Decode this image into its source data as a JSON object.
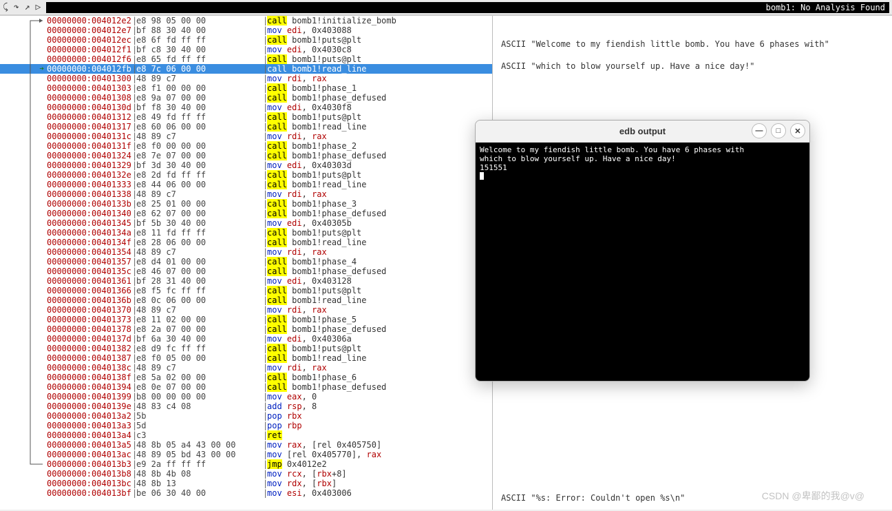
{
  "toolbar": {
    "title": "bomb1: No Analysis Found"
  },
  "info": {
    "ascii1": "ASCII \"Welcome to my fiendish little bomb. You have 6 phases with\"",
    "ascii2": "ASCII \"which to blow yourself up. Have a nice day!\"",
    "bottom": "ASCII \"%s: Error: Couldn't open %s\\n\""
  },
  "output_window": {
    "title": "edb output",
    "lines": "Welcome to my fiendish little bomb. You have 6 phases with\nwhich to blow yourself up. Have a nice day!\n151551"
  },
  "watermark": "CSDN @卑鄙的我@v@",
  "disasm": [
    {
      "g": "",
      "addr": "00000000:004012e2",
      "bytes": "e8 98 05 00 00",
      "mn": "call",
      "hi": true,
      "rest": " bomb1!initialize_bomb"
    },
    {
      "g": "",
      "addr": "00000000:004012e7",
      "bytes": "bf 88 30 40 00",
      "mn": "mov",
      "rest": " ",
      "reg": "edi",
      "after": ", 0x403088"
    },
    {
      "g": "",
      "addr": "00000000:004012ec",
      "bytes": "e8 6f fd ff ff",
      "mn": "call",
      "hi": true,
      "rest": " bomb1!puts@plt"
    },
    {
      "g": "",
      "addr": "00000000:004012f1",
      "bytes": "bf c8 30 40 00",
      "mn": "mov",
      "rest": " ",
      "reg": "edi",
      "after": ", 0x4030c8"
    },
    {
      "g": "",
      "addr": "00000000:004012f6",
      "bytes": "e8 65 fd ff ff",
      "mn": "call",
      "hi": true,
      "rest": " bomb1!puts@plt"
    },
    {
      "g": "rip",
      "sel": true,
      "addr": "00000000:004012fb",
      "bytes": "e8 7c 06 00 00",
      "mn": "call",
      "rest": " bomb1!read_line"
    },
    {
      "g": "",
      "addr": "00000000:00401300",
      "bytes": "48 89 c7",
      "mn": "mov",
      "rest": " ",
      "reg": "rdi",
      "after": ", ",
      "reg2": "rax"
    },
    {
      "g": "",
      "addr": "00000000:00401303",
      "bytes": "e8 f1 00 00 00",
      "mn": "call",
      "hi": true,
      "rest": " bomb1!phase_1"
    },
    {
      "g": "",
      "addr": "00000000:00401308",
      "bytes": "e8 9a 07 00 00",
      "mn": "call",
      "hi": true,
      "rest": " bomb1!phase_defused"
    },
    {
      "g": "",
      "addr": "00000000:0040130d",
      "bytes": "bf f8 30 40 00",
      "mn": "mov",
      "rest": " ",
      "reg": "edi",
      "after": ", 0x4030f8"
    },
    {
      "g": "",
      "addr": "00000000:00401312",
      "bytes": "e8 49 fd ff ff",
      "mn": "call",
      "hi": true,
      "rest": " bomb1!puts@plt"
    },
    {
      "g": "",
      "addr": "00000000:00401317",
      "bytes": "e8 60 06 00 00",
      "mn": "call",
      "hi": true,
      "rest": " bomb1!read_line"
    },
    {
      "g": "",
      "addr": "00000000:0040131c",
      "bytes": "48 89 c7",
      "mn": "mov",
      "rest": " ",
      "reg": "rdi",
      "after": ", ",
      "reg2": "rax"
    },
    {
      "g": "",
      "addr": "00000000:0040131f",
      "bytes": "e8 f0 00 00 00",
      "mn": "call",
      "hi": true,
      "rest": " bomb1!phase_2"
    },
    {
      "g": "",
      "addr": "00000000:00401324",
      "bytes": "e8 7e 07 00 00",
      "mn": "call",
      "hi": true,
      "rest": " bomb1!phase_defused"
    },
    {
      "g": "",
      "addr": "00000000:00401329",
      "bytes": "bf 3d 30 40 00",
      "mn": "mov",
      "rest": " ",
      "reg": "edi",
      "after": ", 0x40303d"
    },
    {
      "g": "",
      "addr": "00000000:0040132e",
      "bytes": "e8 2d fd ff ff",
      "mn": "call",
      "hi": true,
      "rest": " bomb1!puts@plt"
    },
    {
      "g": "",
      "addr": "00000000:00401333",
      "bytes": "e8 44 06 00 00",
      "mn": "call",
      "hi": true,
      "rest": " bomb1!read_line"
    },
    {
      "g": "",
      "addr": "00000000:00401338",
      "bytes": "48 89 c7",
      "mn": "mov",
      "rest": " ",
      "reg": "rdi",
      "after": ", ",
      "reg2": "rax"
    },
    {
      "g": "",
      "addr": "00000000:0040133b",
      "bytes": "e8 25 01 00 00",
      "mn": "call",
      "hi": true,
      "rest": " bomb1!phase_3"
    },
    {
      "g": "",
      "addr": "00000000:00401340",
      "bytes": "e8 62 07 00 00",
      "mn": "call",
      "hi": true,
      "rest": " bomb1!phase_defused"
    },
    {
      "g": "",
      "addr": "00000000:00401345",
      "bytes": "bf 5b 30 40 00",
      "mn": "mov",
      "rest": " ",
      "reg": "edi",
      "after": ", 0x40305b"
    },
    {
      "g": "",
      "addr": "00000000:0040134a",
      "bytes": "e8 11 fd ff ff",
      "mn": "call",
      "hi": true,
      "rest": " bomb1!puts@plt"
    },
    {
      "g": "",
      "addr": "00000000:0040134f",
      "bytes": "e8 28 06 00 00",
      "mn": "call",
      "hi": true,
      "rest": " bomb1!read_line"
    },
    {
      "g": "",
      "addr": "00000000:00401354",
      "bytes": "48 89 c7",
      "mn": "mov",
      "rest": " ",
      "reg": "rdi",
      "after": ", ",
      "reg2": "rax"
    },
    {
      "g": "",
      "addr": "00000000:00401357",
      "bytes": "e8 d4 01 00 00",
      "mn": "call",
      "hi": true,
      "rest": " bomb1!phase_4"
    },
    {
      "g": "",
      "addr": "00000000:0040135c",
      "bytes": "e8 46 07 00 00",
      "mn": "call",
      "hi": true,
      "rest": " bomb1!phase_defused"
    },
    {
      "g": "",
      "addr": "00000000:00401361",
      "bytes": "bf 28 31 40 00",
      "mn": "mov",
      "rest": " ",
      "reg": "edi",
      "after": ", 0x403128"
    },
    {
      "g": "",
      "addr": "00000000:00401366",
      "bytes": "e8 f5 fc ff ff",
      "mn": "call",
      "hi": true,
      "rest": " bomb1!puts@plt"
    },
    {
      "g": "",
      "addr": "00000000:0040136b",
      "bytes": "e8 0c 06 00 00",
      "mn": "call",
      "hi": true,
      "rest": " bomb1!read_line"
    },
    {
      "g": "",
      "addr": "00000000:00401370",
      "bytes": "48 89 c7",
      "mn": "mov",
      "rest": " ",
      "reg": "rdi",
      "after": ", ",
      "reg2": "rax"
    },
    {
      "g": "",
      "addr": "00000000:00401373",
      "bytes": "e8 11 02 00 00",
      "mn": "call",
      "hi": true,
      "rest": " bomb1!phase_5"
    },
    {
      "g": "",
      "addr": "00000000:00401378",
      "bytes": "e8 2a 07 00 00",
      "mn": "call",
      "hi": true,
      "rest": " bomb1!phase_defused"
    },
    {
      "g": "",
      "addr": "00000000:0040137d",
      "bytes": "bf 6a 30 40 00",
      "mn": "mov",
      "rest": " ",
      "reg": "edi",
      "after": ", 0x40306a"
    },
    {
      "g": "",
      "addr": "00000000:00401382",
      "bytes": "e8 d9 fc ff ff",
      "mn": "call",
      "hi": true,
      "rest": " bomb1!puts@plt"
    },
    {
      "g": "",
      "addr": "00000000:00401387",
      "bytes": "e8 f0 05 00 00",
      "mn": "call",
      "hi": true,
      "rest": " bomb1!read_line"
    },
    {
      "g": "",
      "addr": "00000000:0040138c",
      "bytes": "48 89 c7",
      "mn": "mov",
      "rest": " ",
      "reg": "rdi",
      "after": ", ",
      "reg2": "rax"
    },
    {
      "g": "",
      "addr": "00000000:0040138f",
      "bytes": "e8 5a 02 00 00",
      "mn": "call",
      "hi": true,
      "rest": " bomb1!phase_6"
    },
    {
      "g": "",
      "addr": "00000000:00401394",
      "bytes": "e8 0e 07 00 00",
      "mn": "call",
      "hi": true,
      "rest": " bomb1!phase_defused"
    },
    {
      "g": "",
      "addr": "00000000:00401399",
      "bytes": "b8 00 00 00 00",
      "mn": "mov",
      "rest": " ",
      "reg": "eax",
      "after": ", 0"
    },
    {
      "g": "",
      "addr": "00000000:0040139e",
      "bytes": "48 83 c4 08",
      "mn": "add",
      "rest": " ",
      "reg": "rsp",
      "after": ", 8"
    },
    {
      "g": "",
      "addr": "00000000:004013a2",
      "bytes": "5b",
      "mn": "pop",
      "rest": " ",
      "reg": "rbx"
    },
    {
      "g": "",
      "addr": "00000000:004013a3",
      "bytes": "5d",
      "mn": "pop",
      "rest": " ",
      "reg": "rbp"
    },
    {
      "g": "",
      "addr": "00000000:004013a4",
      "bytes": "c3",
      "mn": "ret",
      "hi": true,
      "rest": ""
    },
    {
      "g": "",
      "addr": "00000000:004013a5",
      "bytes": "48 8b 05 a4 43 00 00",
      "mn": "mov",
      "rest": " ",
      "reg": "rax",
      "after": ", [rel 0x405750]"
    },
    {
      "g": "",
      "addr": "00000000:004013ac",
      "bytes": "48 89 05 bd 43 00 00",
      "mn": "mov",
      "rest": " [rel 0x405770], ",
      "reg": "rax"
    },
    {
      "g": "",
      "addr": "00000000:004013b3",
      "bytes": "e9 2a ff ff ff",
      "mn": "jmp",
      "hi": true,
      "rest": " 0x4012e2"
    },
    {
      "g": "",
      "addr": "00000000:004013b8",
      "bytes": "48 8b 4b 08",
      "mn": "mov",
      "rest": " ",
      "reg": "rcx",
      "after": ", [",
      "reg2": "rbx",
      "after2": "+8]"
    },
    {
      "g": "",
      "addr": "00000000:004013bc",
      "bytes": "48 8b 13",
      "mn": "mov",
      "rest": " ",
      "reg": "rdx",
      "after": ", [",
      "reg2": "rbx",
      "after2": "]"
    },
    {
      "g": "",
      "addr": "00000000:004013bf",
      "bytes": "be 06 30 40 00",
      "mn": "mov",
      "rest": " ",
      "reg": "esi",
      "after": ", 0x403006"
    }
  ]
}
